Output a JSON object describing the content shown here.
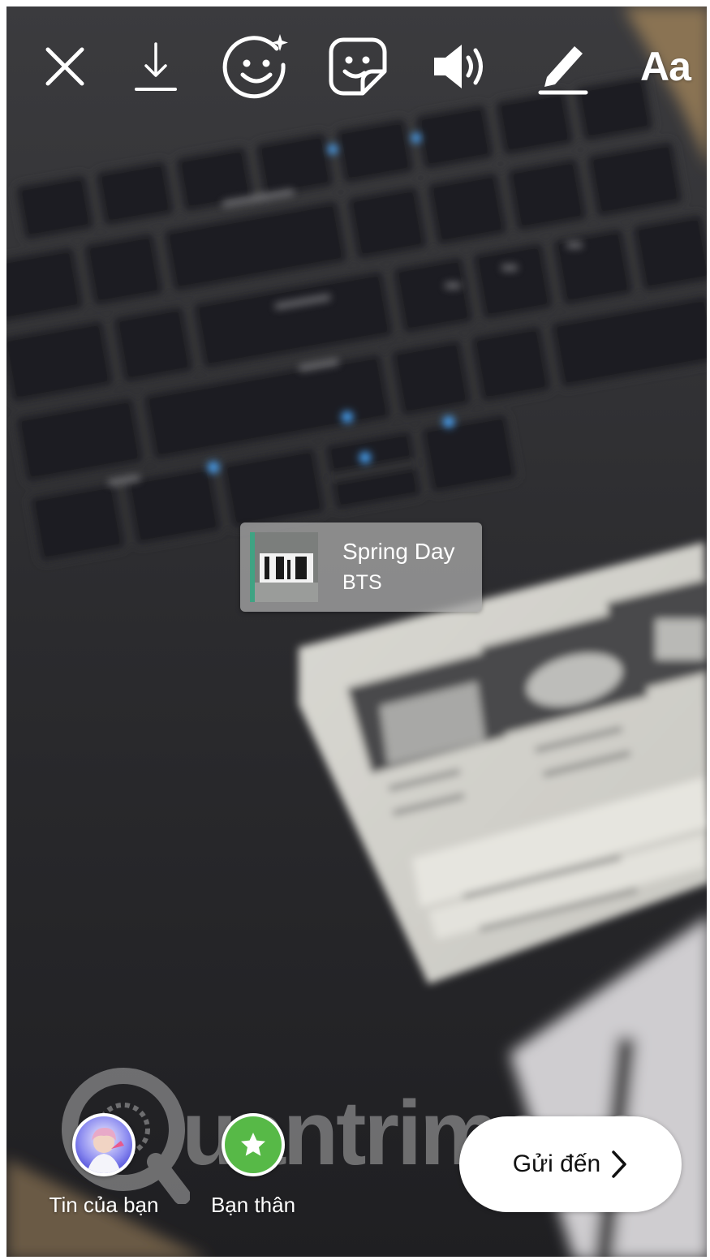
{
  "toolbar": {
    "close_icon": "close-icon",
    "download_icon": "download-icon",
    "effects_icon": "face-effects-icon",
    "sticker_icon": "sticker-icon",
    "sound_icon": "speaker-icon",
    "draw_icon": "pen-icon",
    "text_label": "Aa"
  },
  "music_sticker": {
    "title": "Spring Day",
    "artist": "BTS",
    "accent_color": "#3fa383"
  },
  "watermark": {
    "text": "uantrimang"
  },
  "share": {
    "your_story_label": "Tin của bạn",
    "close_friends_label": "Bạn thân",
    "close_friends_color": "#57b947",
    "send_label": "Gửi đến"
  }
}
